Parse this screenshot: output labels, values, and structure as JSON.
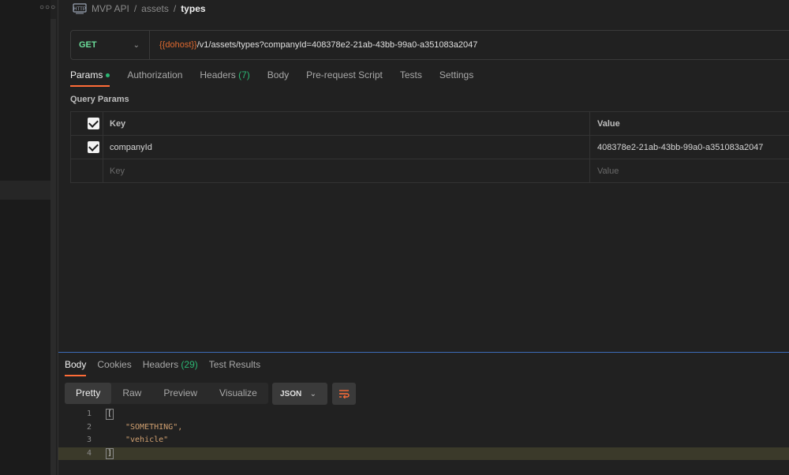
{
  "sidebar": {
    "more_icon": "ellipsis-icon"
  },
  "breadcrumb": {
    "icon": "http-request-icon",
    "collection": "MVP API",
    "folder": "assets",
    "current": "types",
    "separator": "/"
  },
  "request": {
    "method": "GET",
    "url_variable": "{{dohost}}",
    "url_path": "/v1/assets/types?companyId=408378e2-21ab-43bb-99a0-a351083a2047"
  },
  "request_tabs": [
    {
      "label": "Params",
      "active": true,
      "indicator": "green-dot"
    },
    {
      "label": "Authorization"
    },
    {
      "label": "Headers",
      "count": "(7)"
    },
    {
      "label": "Body"
    },
    {
      "label": "Pre-request Script"
    },
    {
      "label": "Tests"
    },
    {
      "label": "Settings"
    }
  ],
  "query_params": {
    "title": "Query Params",
    "headers": {
      "key": "Key",
      "value": "Value"
    },
    "rows": [
      {
        "key": "companyId",
        "value": "408378e2-21ab-43bb-99a0-a351083a2047",
        "checked": true
      }
    ],
    "placeholder": {
      "key": "Key",
      "value": "Value"
    }
  },
  "response_tabs": [
    {
      "label": "Body",
      "active": true
    },
    {
      "label": "Cookies"
    },
    {
      "label": "Headers",
      "count": "(29)"
    },
    {
      "label": "Test Results"
    }
  ],
  "response_view": {
    "modes": [
      "Pretty",
      "Raw",
      "Preview",
      "Visualize"
    ],
    "active_mode": "Pretty",
    "format": "JSON",
    "wrap_icon": "wrap-lines-icon"
  },
  "response_body": [
    {
      "n": "1",
      "text": "["
    },
    {
      "n": "2",
      "text": "\"SOMETHING\","
    },
    {
      "n": "3",
      "text": "\"vehicle\""
    },
    {
      "n": "4",
      "text": "]"
    }
  ],
  "colors": {
    "accent": "#ff6c37",
    "method_get": "#6bdd9a",
    "variable": "#e0692f",
    "count_green": "#2bb673"
  }
}
